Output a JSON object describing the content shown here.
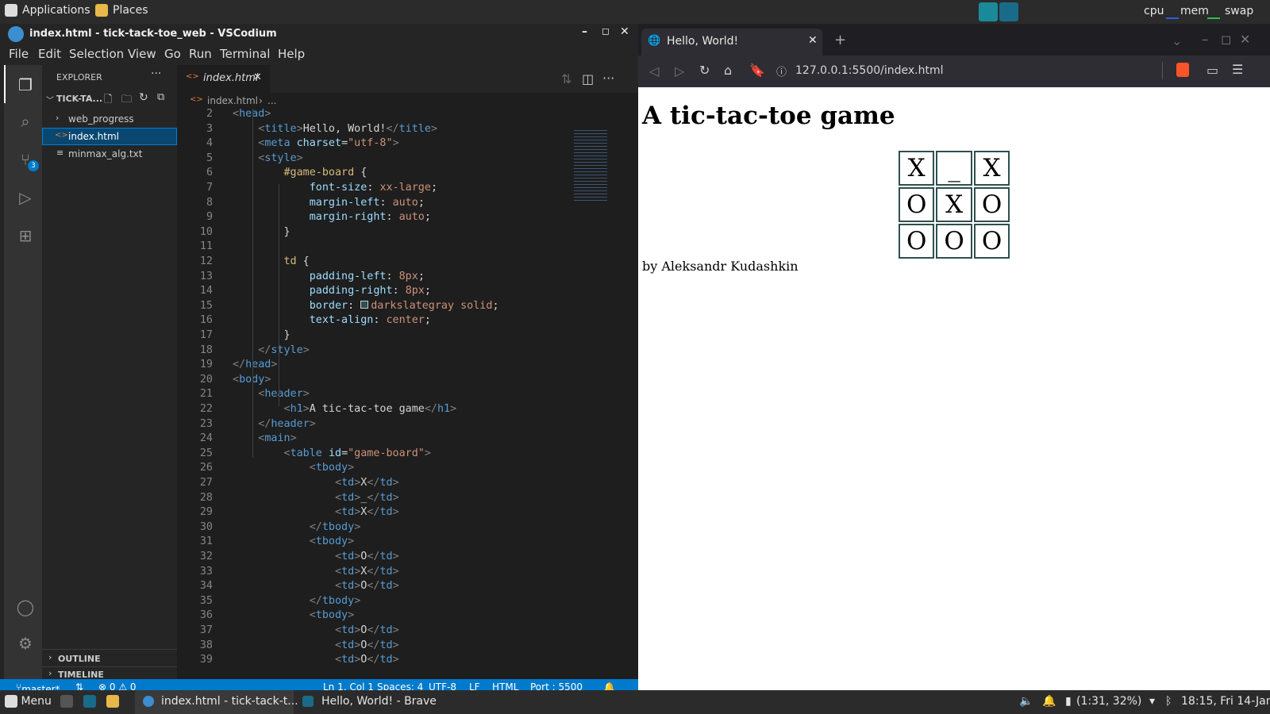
{
  "top_panel": {
    "applications": "Applications",
    "places": "Places",
    "monitors": [
      "cpu",
      "mem",
      "swap"
    ]
  },
  "vscode": {
    "title": "index.html - tick-tack-toe_web - VSCodium",
    "menu": [
      "File",
      "Edit",
      "Selection",
      "View",
      "Go",
      "Run",
      "Terminal",
      "Help"
    ],
    "source_control_badge": "3",
    "explorer": {
      "header": "EXPLORER",
      "folder": "TICK-TA...",
      "items": [
        "web_progress",
        "index.html",
        "minmax_alg.txt"
      ],
      "outline": "OUTLINE",
      "timeline": "TIMELINE"
    },
    "tab": "index.html",
    "breadcrumb": [
      "index.html",
      "..."
    ],
    "code_lines": [
      {
        "n": "2",
        "t": "<head>"
      },
      {
        "n": "3",
        "t": "    <title>Hello, World!</title>"
      },
      {
        "n": "4",
        "t": "    <meta charset=\"utf-8\">"
      },
      {
        "n": "5",
        "t": "    <style>"
      },
      {
        "n": "6",
        "t": "        #game-board {"
      },
      {
        "n": "7",
        "t": "            font-size: xx-large;"
      },
      {
        "n": "8",
        "t": "            margin-left: auto;"
      },
      {
        "n": "9",
        "t": "            margin-right: auto;"
      },
      {
        "n": "10",
        "t": "        }"
      },
      {
        "n": "11",
        "t": ""
      },
      {
        "n": "12",
        "t": "        td {"
      },
      {
        "n": "13",
        "t": "            padding-left: 8px;"
      },
      {
        "n": "14",
        "t": "            padding-right: 8px;"
      },
      {
        "n": "15",
        "t": "            border: □darkslategray solid;"
      },
      {
        "n": "16",
        "t": "            text-align: center;"
      },
      {
        "n": "17",
        "t": "        }"
      },
      {
        "n": "18",
        "t": "    </style>"
      },
      {
        "n": "19",
        "t": "</head>"
      },
      {
        "n": "20",
        "t": "<body>"
      },
      {
        "n": "21",
        "t": "    <header>"
      },
      {
        "n": "22",
        "t": "        <h1>A tic-tac-toe game</h1>"
      },
      {
        "n": "23",
        "t": "    </header>"
      },
      {
        "n": "24",
        "t": "    <main>"
      },
      {
        "n": "25",
        "t": "        <table id=\"game-board\">"
      },
      {
        "n": "26",
        "t": "            <tbody>"
      },
      {
        "n": "27",
        "t": "                <td>X</td>"
      },
      {
        "n": "28",
        "t": "                <td>_</td>"
      },
      {
        "n": "29",
        "t": "                <td>X</td>"
      },
      {
        "n": "30",
        "t": "            </tbody>"
      },
      {
        "n": "31",
        "t": "            <tbody>"
      },
      {
        "n": "32",
        "t": "                <td>O</td>"
      },
      {
        "n": "33",
        "t": "                <td>X</td>"
      },
      {
        "n": "34",
        "t": "                <td>O</td>"
      },
      {
        "n": "35",
        "t": "            </tbody>"
      },
      {
        "n": "36",
        "t": "            <tbody>"
      },
      {
        "n": "37",
        "t": "                <td>O</td>"
      },
      {
        "n": "38",
        "t": "                <td>O</td>"
      },
      {
        "n": "39",
        "t": "                <td>O</td>"
      }
    ],
    "status": {
      "branch": "master*",
      "problems": "⊗ 0 ⚠ 0",
      "position": "Ln 1, Col 1",
      "spaces": "Spaces: 4",
      "encoding": "UTF-8",
      "eol": "LF",
      "language": "HTML",
      "port": "Port : 5500"
    }
  },
  "browser": {
    "tab_title": "Hello, World!",
    "url": "127.0.0.1:5500/index.html",
    "page": {
      "heading": "A tic-tac-toe game",
      "board": [
        [
          "X",
          "_",
          "X"
        ],
        [
          "O",
          "X",
          "O"
        ],
        [
          "O",
          "O",
          "O"
        ]
      ],
      "byline": "by Aleksandr Kudashkin"
    }
  },
  "taskbar": {
    "menu": "Menu",
    "windows": [
      "index.html - tick-tack-t...",
      "Hello, World! - Brave"
    ],
    "battery": "(1:31, 32%)",
    "clock": "18:15, Fri 14-Jan"
  }
}
